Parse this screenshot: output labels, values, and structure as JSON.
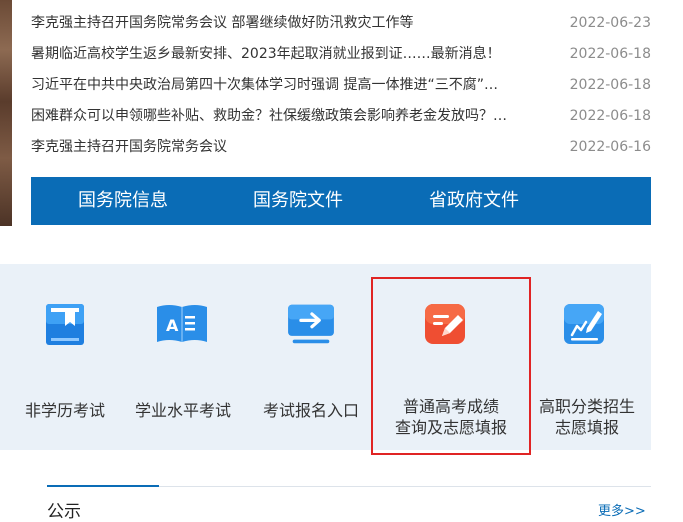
{
  "news": [
    {
      "title": "李克强主持召开国务院常务会议 部署继续做好防汛救灾工作等",
      "date": "2022-06-23"
    },
    {
      "title": "暑期临近高校学生返乡最新安排、2023年起取消就业报到证……最新消息！",
      "date": "2022-06-18"
    },
    {
      "title": "习近平在中共中央政治局第四十次集体学习时强调 提高一体推进“三不腐”…",
      "date": "2022-06-18"
    },
    {
      "title": "困难群众可以申领哪些补贴、救助金？社保缓缴政策会影响养老金发放吗？…",
      "date": "2022-06-18"
    },
    {
      "title": "李克强主持召开国务院常务会议",
      "date": "2022-06-16"
    }
  ],
  "tabs": [
    {
      "label": "国务院信息"
    },
    {
      "label": "国务院文件"
    },
    {
      "label": "省政府文件"
    }
  ],
  "services": [
    {
      "label_line1": "非学历考试",
      "label_line2": "",
      "icon": "book-flag-icon"
    },
    {
      "label_line1": "学业水平考试",
      "label_line2": "",
      "icon": "open-book-a-icon"
    },
    {
      "label_line1": "考试报名入口",
      "label_line2": "",
      "icon": "monitor-arrow-icon"
    },
    {
      "label_line1": "普通高考成绩",
      "label_line2": "查询及志愿填报",
      "icon": "edit-note-icon"
    },
    {
      "label_line1": "高职分类招生",
      "label_line2": "志愿填报",
      "icon": "chart-pen-icon"
    }
  ],
  "notice": {
    "title": "公示",
    "more": "更多>>"
  },
  "colors": {
    "brand_blue": "#0a6cb6",
    "panel_bg": "#eaf1f8",
    "highlight_red": "#e02424",
    "icon_orange_red": "#ef4e32",
    "icon_blue": "#2a8ee8"
  }
}
